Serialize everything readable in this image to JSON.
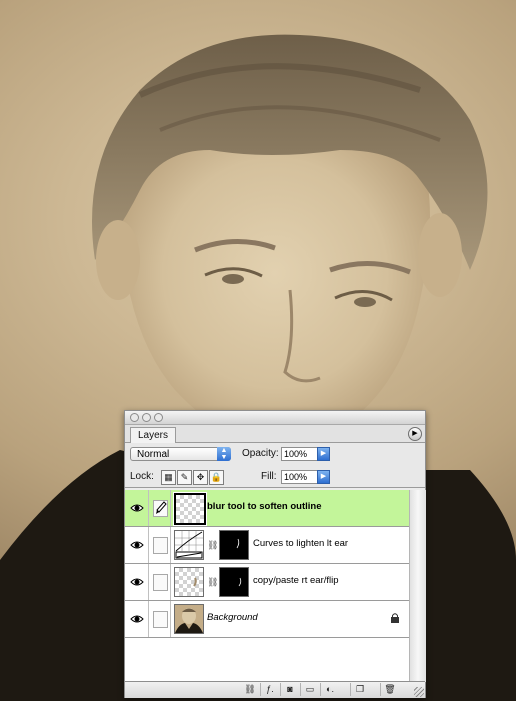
{
  "panel": {
    "tab_label": "Layers",
    "menu_icon": "flyout-menu-icon",
    "blend_mode": "Normal",
    "opacity_label": "Opacity:",
    "opacity_value": "100%",
    "lock_label": "Lock:",
    "fill_label": "Fill:",
    "fill_value": "100%"
  },
  "layers": [
    {
      "name": "blur tool to soften outline",
      "selected": true,
      "visible": true
    },
    {
      "name": "Curves to lighten lt ear",
      "selected": false,
      "visible": true
    },
    {
      "name": "copy/paste rt ear/flip",
      "selected": false,
      "visible": true
    },
    {
      "name": "Background",
      "selected": false,
      "visible": true,
      "locked": true
    }
  ],
  "bottom_buttons": [
    "link-layers-icon",
    "add-layer-style-icon",
    "add-mask-icon",
    "new-group-icon",
    "new-adjustment-layer-icon",
    "new-layer-icon",
    "trash-icon"
  ],
  "colors": {
    "selected_layer": "#c3f59a",
    "accent_blue": "#2e6fd1"
  }
}
